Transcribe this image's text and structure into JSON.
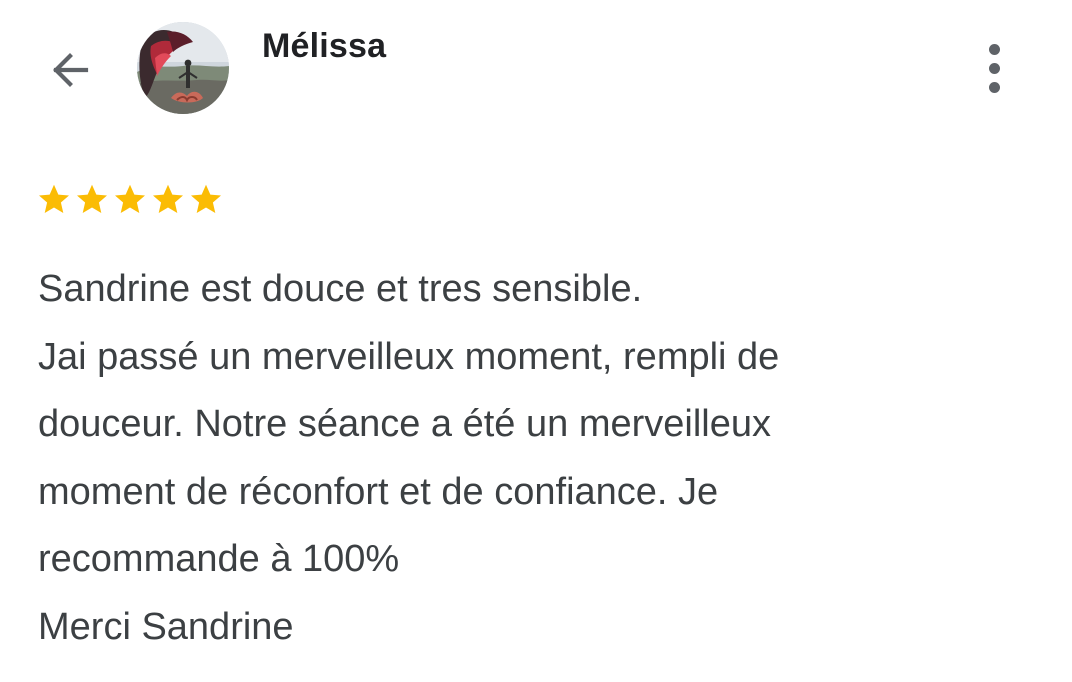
{
  "header": {
    "back_icon": "arrow-back-icon",
    "avatar_icon": "profile-photo",
    "reviewer_name": "Mélissa",
    "more_icon": "more-vertical-icon"
  },
  "review": {
    "rating": 5,
    "rating_max": 5,
    "star_color": "#fbbc04",
    "lines": [
      "Sandrine est douce et tres sensible.",
      "Jai passé un merveilleux moment, rempli de",
      "douceur. Notre séance a été un merveilleux",
      "moment de réconfort et de confiance. Je",
      "recommande à 100%",
      "Merci Sandrine"
    ]
  }
}
